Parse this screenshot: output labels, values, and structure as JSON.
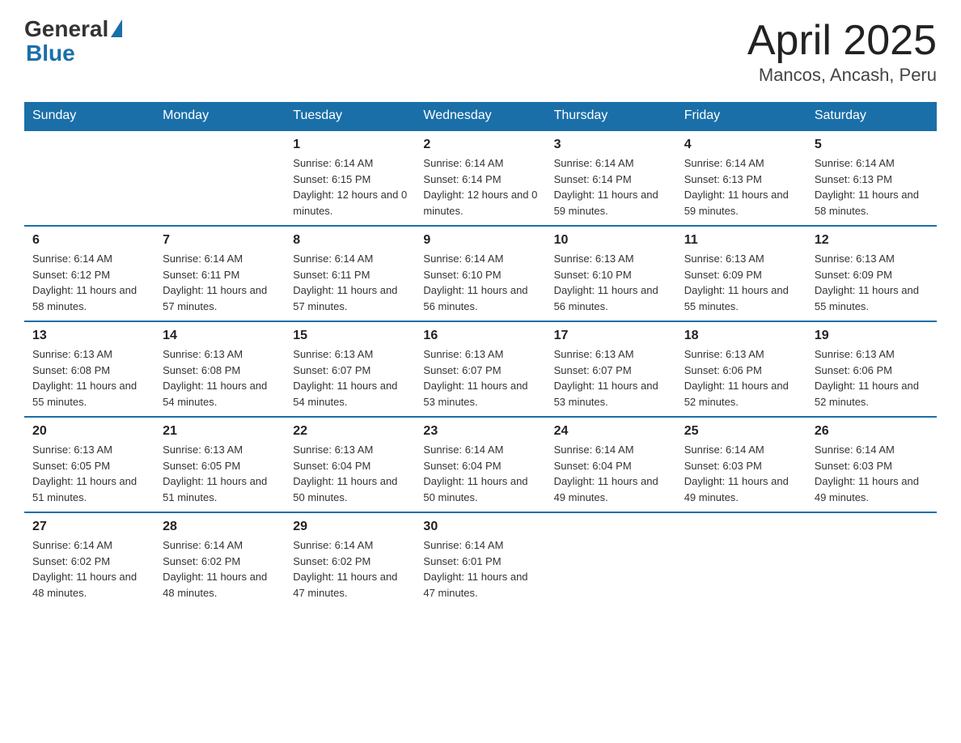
{
  "logo": {
    "general": "General",
    "blue": "Blue"
  },
  "title": "April 2025",
  "subtitle": "Mancos, Ancash, Peru",
  "weekdays": [
    "Sunday",
    "Monday",
    "Tuesday",
    "Wednesday",
    "Thursday",
    "Friday",
    "Saturday"
  ],
  "weeks": [
    [
      {
        "day": "",
        "sunrise": "",
        "sunset": "",
        "daylight": ""
      },
      {
        "day": "",
        "sunrise": "",
        "sunset": "",
        "daylight": ""
      },
      {
        "day": "1",
        "sunrise": "Sunrise: 6:14 AM",
        "sunset": "Sunset: 6:15 PM",
        "daylight": "Daylight: 12 hours and 0 minutes."
      },
      {
        "day": "2",
        "sunrise": "Sunrise: 6:14 AM",
        "sunset": "Sunset: 6:14 PM",
        "daylight": "Daylight: 12 hours and 0 minutes."
      },
      {
        "day": "3",
        "sunrise": "Sunrise: 6:14 AM",
        "sunset": "Sunset: 6:14 PM",
        "daylight": "Daylight: 11 hours and 59 minutes."
      },
      {
        "day": "4",
        "sunrise": "Sunrise: 6:14 AM",
        "sunset": "Sunset: 6:13 PM",
        "daylight": "Daylight: 11 hours and 59 minutes."
      },
      {
        "day": "5",
        "sunrise": "Sunrise: 6:14 AM",
        "sunset": "Sunset: 6:13 PM",
        "daylight": "Daylight: 11 hours and 58 minutes."
      }
    ],
    [
      {
        "day": "6",
        "sunrise": "Sunrise: 6:14 AM",
        "sunset": "Sunset: 6:12 PM",
        "daylight": "Daylight: 11 hours and 58 minutes."
      },
      {
        "day": "7",
        "sunrise": "Sunrise: 6:14 AM",
        "sunset": "Sunset: 6:11 PM",
        "daylight": "Daylight: 11 hours and 57 minutes."
      },
      {
        "day": "8",
        "sunrise": "Sunrise: 6:14 AM",
        "sunset": "Sunset: 6:11 PM",
        "daylight": "Daylight: 11 hours and 57 minutes."
      },
      {
        "day": "9",
        "sunrise": "Sunrise: 6:14 AM",
        "sunset": "Sunset: 6:10 PM",
        "daylight": "Daylight: 11 hours and 56 minutes."
      },
      {
        "day": "10",
        "sunrise": "Sunrise: 6:13 AM",
        "sunset": "Sunset: 6:10 PM",
        "daylight": "Daylight: 11 hours and 56 minutes."
      },
      {
        "day": "11",
        "sunrise": "Sunrise: 6:13 AM",
        "sunset": "Sunset: 6:09 PM",
        "daylight": "Daylight: 11 hours and 55 minutes."
      },
      {
        "day": "12",
        "sunrise": "Sunrise: 6:13 AM",
        "sunset": "Sunset: 6:09 PM",
        "daylight": "Daylight: 11 hours and 55 minutes."
      }
    ],
    [
      {
        "day": "13",
        "sunrise": "Sunrise: 6:13 AM",
        "sunset": "Sunset: 6:08 PM",
        "daylight": "Daylight: 11 hours and 55 minutes."
      },
      {
        "day": "14",
        "sunrise": "Sunrise: 6:13 AM",
        "sunset": "Sunset: 6:08 PM",
        "daylight": "Daylight: 11 hours and 54 minutes."
      },
      {
        "day": "15",
        "sunrise": "Sunrise: 6:13 AM",
        "sunset": "Sunset: 6:07 PM",
        "daylight": "Daylight: 11 hours and 54 minutes."
      },
      {
        "day": "16",
        "sunrise": "Sunrise: 6:13 AM",
        "sunset": "Sunset: 6:07 PM",
        "daylight": "Daylight: 11 hours and 53 minutes."
      },
      {
        "day": "17",
        "sunrise": "Sunrise: 6:13 AM",
        "sunset": "Sunset: 6:07 PM",
        "daylight": "Daylight: 11 hours and 53 minutes."
      },
      {
        "day": "18",
        "sunrise": "Sunrise: 6:13 AM",
        "sunset": "Sunset: 6:06 PM",
        "daylight": "Daylight: 11 hours and 52 minutes."
      },
      {
        "day": "19",
        "sunrise": "Sunrise: 6:13 AM",
        "sunset": "Sunset: 6:06 PM",
        "daylight": "Daylight: 11 hours and 52 minutes."
      }
    ],
    [
      {
        "day": "20",
        "sunrise": "Sunrise: 6:13 AM",
        "sunset": "Sunset: 6:05 PM",
        "daylight": "Daylight: 11 hours and 51 minutes."
      },
      {
        "day": "21",
        "sunrise": "Sunrise: 6:13 AM",
        "sunset": "Sunset: 6:05 PM",
        "daylight": "Daylight: 11 hours and 51 minutes."
      },
      {
        "day": "22",
        "sunrise": "Sunrise: 6:13 AM",
        "sunset": "Sunset: 6:04 PM",
        "daylight": "Daylight: 11 hours and 50 minutes."
      },
      {
        "day": "23",
        "sunrise": "Sunrise: 6:14 AM",
        "sunset": "Sunset: 6:04 PM",
        "daylight": "Daylight: 11 hours and 50 minutes."
      },
      {
        "day": "24",
        "sunrise": "Sunrise: 6:14 AM",
        "sunset": "Sunset: 6:04 PM",
        "daylight": "Daylight: 11 hours and 49 minutes."
      },
      {
        "day": "25",
        "sunrise": "Sunrise: 6:14 AM",
        "sunset": "Sunset: 6:03 PM",
        "daylight": "Daylight: 11 hours and 49 minutes."
      },
      {
        "day": "26",
        "sunrise": "Sunrise: 6:14 AM",
        "sunset": "Sunset: 6:03 PM",
        "daylight": "Daylight: 11 hours and 49 minutes."
      }
    ],
    [
      {
        "day": "27",
        "sunrise": "Sunrise: 6:14 AM",
        "sunset": "Sunset: 6:02 PM",
        "daylight": "Daylight: 11 hours and 48 minutes."
      },
      {
        "day": "28",
        "sunrise": "Sunrise: 6:14 AM",
        "sunset": "Sunset: 6:02 PM",
        "daylight": "Daylight: 11 hours and 48 minutes."
      },
      {
        "day": "29",
        "sunrise": "Sunrise: 6:14 AM",
        "sunset": "Sunset: 6:02 PM",
        "daylight": "Daylight: 11 hours and 47 minutes."
      },
      {
        "day": "30",
        "sunrise": "Sunrise: 6:14 AM",
        "sunset": "Sunset: 6:01 PM",
        "daylight": "Daylight: 11 hours and 47 minutes."
      },
      {
        "day": "",
        "sunrise": "",
        "sunset": "",
        "daylight": ""
      },
      {
        "day": "",
        "sunrise": "",
        "sunset": "",
        "daylight": ""
      },
      {
        "day": "",
        "sunrise": "",
        "sunset": "",
        "daylight": ""
      }
    ]
  ]
}
